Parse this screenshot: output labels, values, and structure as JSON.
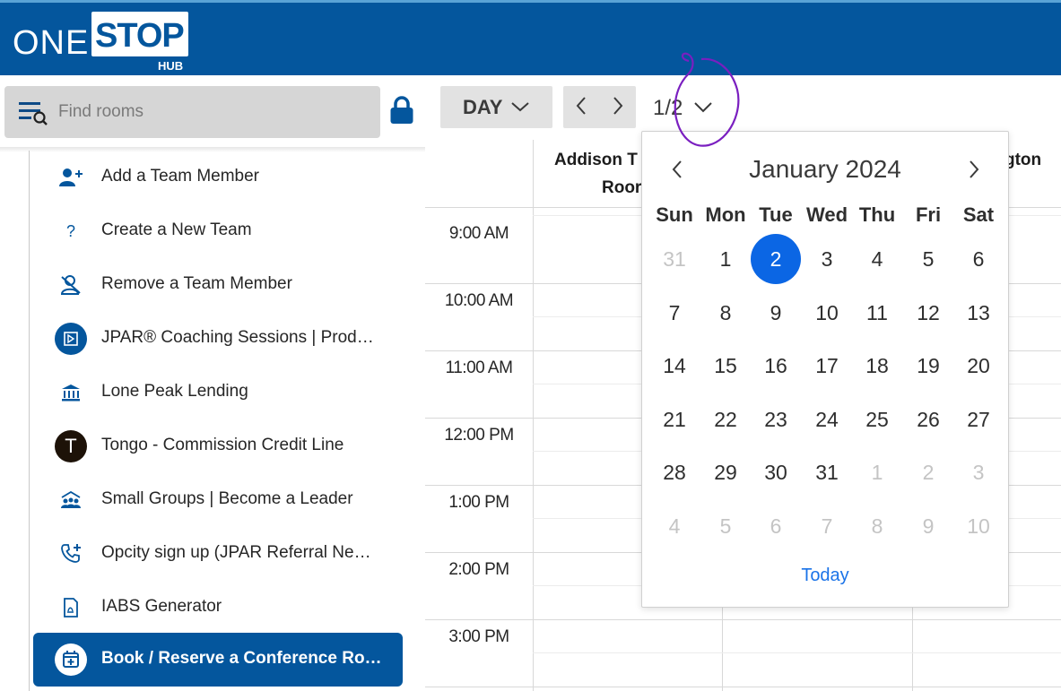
{
  "app": {
    "logo": {
      "word1": "ONE",
      "word2": "STOP",
      "sub": "HUB"
    },
    "brand_color": "#04569d",
    "accent_color": "#0b66e4"
  },
  "search": {
    "placeholder": "Find rooms",
    "value": ""
  },
  "menu": {
    "items": [
      {
        "label": "Add a Team Member",
        "icon": "add-person-icon"
      },
      {
        "label": "Create a New Team",
        "icon": "question-icon"
      },
      {
        "label": "Remove a Team Member",
        "icon": "remove-person-icon"
      },
      {
        "label": "JPAR® Coaching Sessions | Prod…",
        "icon": "coaching-logo-icon"
      },
      {
        "label": "Lone Peak Lending",
        "icon": "bank-icon"
      },
      {
        "label": "Tongo - Commission Credit Line",
        "icon": "tongo-logo-icon",
        "icon_text": "T"
      },
      {
        "label": "Small Groups | Become a Leader",
        "icon": "group-icon"
      },
      {
        "label": "Opcity sign up (JPAR Referral Ne…",
        "icon": "phone-plus-icon"
      },
      {
        "label": "IABS Generator",
        "icon": "document-icon"
      },
      {
        "label": "Book / Reserve a Conference Ro…",
        "icon": "calendar-plus-icon",
        "active": true
      }
    ]
  },
  "toolbar": {
    "view_label": "DAY",
    "date_label": "1/2"
  },
  "grid": {
    "rooms": [
      {
        "line1": "Addison T",
        "line2": "Roor"
      },
      {
        "line1": "gton",
        "line2": ""
      }
    ],
    "times": [
      "9:00 AM",
      "10:00 AM",
      "11:00 AM",
      "12:00 PM",
      "1:00 PM",
      "2:00 PM",
      "3:00 PM"
    ]
  },
  "calendar": {
    "title": "January 2024",
    "weekdays": [
      "Sun",
      "Mon",
      "Tue",
      "Wed",
      "Thu",
      "Fri",
      "Sat"
    ],
    "weeks": [
      [
        {
          "d": "31",
          "out": true
        },
        {
          "d": "1"
        },
        {
          "d": "2",
          "selected": true
        },
        {
          "d": "3"
        },
        {
          "d": "4"
        },
        {
          "d": "5"
        },
        {
          "d": "6"
        }
      ],
      [
        {
          "d": "7"
        },
        {
          "d": "8"
        },
        {
          "d": "9"
        },
        {
          "d": "10"
        },
        {
          "d": "11"
        },
        {
          "d": "12"
        },
        {
          "d": "13"
        }
      ],
      [
        {
          "d": "14"
        },
        {
          "d": "15"
        },
        {
          "d": "16"
        },
        {
          "d": "17"
        },
        {
          "d": "18"
        },
        {
          "d": "19"
        },
        {
          "d": "20"
        }
      ],
      [
        {
          "d": "21"
        },
        {
          "d": "22"
        },
        {
          "d": "23"
        },
        {
          "d": "24"
        },
        {
          "d": "25"
        },
        {
          "d": "26"
        },
        {
          "d": "27"
        }
      ],
      [
        {
          "d": "28"
        },
        {
          "d": "29"
        },
        {
          "d": "30"
        },
        {
          "d": "31"
        },
        {
          "d": "1",
          "out": true
        },
        {
          "d": "2",
          "out": true
        },
        {
          "d": "3",
          "out": true
        }
      ],
      [
        {
          "d": "4",
          "out": true
        },
        {
          "d": "5",
          "out": true
        },
        {
          "d": "6",
          "out": true
        },
        {
          "d": "7",
          "out": true
        },
        {
          "d": "8",
          "out": true
        },
        {
          "d": "9",
          "out": true
        },
        {
          "d": "10",
          "out": true
        }
      ]
    ],
    "today_label": "Today"
  }
}
